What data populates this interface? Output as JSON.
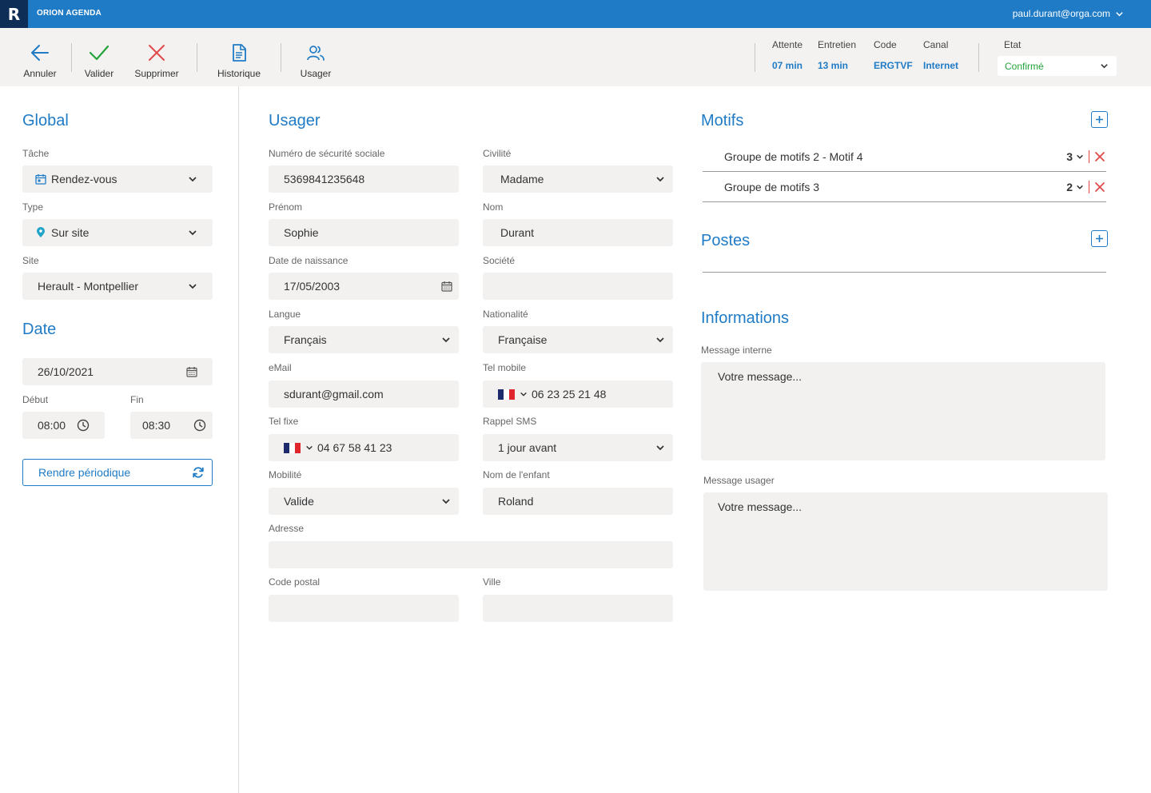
{
  "app": {
    "logo_letter": "R",
    "title": "ORION AGENDA",
    "user_email": "paul.durant@orga.com"
  },
  "toolbar": {
    "annuler": "Annuler",
    "valider": "Valider",
    "supprimer": "Supprimer",
    "historique": "Historique",
    "usager": "Usager"
  },
  "info": {
    "attente": {
      "label": "Attente",
      "value": "07 min"
    },
    "entretien": {
      "label": "Entretien",
      "value": "13 min"
    },
    "code": {
      "label": "Code",
      "value": "ERGTVF"
    },
    "canal": {
      "label": "Canal",
      "value": "Internet"
    },
    "etat": {
      "label": "Etat",
      "value": "Confirmé"
    }
  },
  "global": {
    "title": "Global",
    "tache_label": "Tâche",
    "tache_value": "Rendez-vous",
    "type_label": "Type",
    "type_value": "Sur site",
    "site_label": "Site",
    "site_value": "Herault - Montpellier"
  },
  "date": {
    "title": "Date",
    "date_value": "26/10/2021",
    "debut_label": "Début",
    "debut_value": "08:00",
    "fin_label": "Fin",
    "fin_value": "08:30",
    "periodic_button": "Rendre périodique"
  },
  "usager": {
    "title": "Usager",
    "nss_label": "Numéro de sécurité sociale",
    "nss_value": "5369841235648",
    "civilite_label": "Civilité",
    "civilite_value": "Madame",
    "prenom_label": "Prénom",
    "prenom_value": "Sophie",
    "nom_label": "Nom",
    "nom_value": "Durant",
    "naissance_label": "Date de naissance",
    "naissance_value": "17/05/2003",
    "societe_label": "Société",
    "societe_value": "",
    "langue_label": "Langue",
    "langue_value": "Français",
    "nationalite_label": "Nationalité",
    "nationalite_value": "Française",
    "email_label": "eMail",
    "email_value": "sdurant@gmail.com",
    "telmobile_label": "Tel mobile",
    "telmobile_value": "06 23 25 21 48",
    "telfixe_label": "Tel fixe",
    "telfixe_value": "04 67 58 41 23",
    "rappel_label": "Rappel SMS",
    "rappel_value": "1 jour avant",
    "mobilite_label": "Mobilité",
    "mobilite_value": "Valide",
    "enfant_label": "Nom de l'enfant",
    "enfant_value": "Roland",
    "adresse_label": "Adresse",
    "adresse_value": "",
    "cp_label": "Code postal",
    "cp_value": "",
    "ville_label": "Ville",
    "ville_value": ""
  },
  "motifs": {
    "title": "Motifs",
    "items": [
      {
        "name": "Groupe de motifs 2 - Motif 4",
        "qty": "3"
      },
      {
        "name": "Groupe de motifs 3",
        "qty": "2"
      }
    ]
  },
  "postes": {
    "title": "Postes"
  },
  "informations": {
    "title": "Informations",
    "interne_label": "Message interne",
    "interne_placeholder": "Votre message...",
    "usager_label": "Message usager",
    "usager_placeholder": "Votre message..."
  },
  "colors": {
    "primary": "#1f7bc6",
    "logo_bg": "#0e2d57",
    "success": "#22a33a",
    "danger": "#e24a4a",
    "field_bg": "#f2f1f0",
    "toolbar_bg": "#f3f2f1"
  },
  "icons": [
    "arrow-left-icon",
    "check-icon",
    "close-icon",
    "document-icon",
    "users-icon",
    "chevron-down-icon",
    "calendar-icon",
    "location-pin-icon",
    "clock-icon",
    "refresh-icon",
    "plus-icon",
    "flag-fr-icon"
  ]
}
